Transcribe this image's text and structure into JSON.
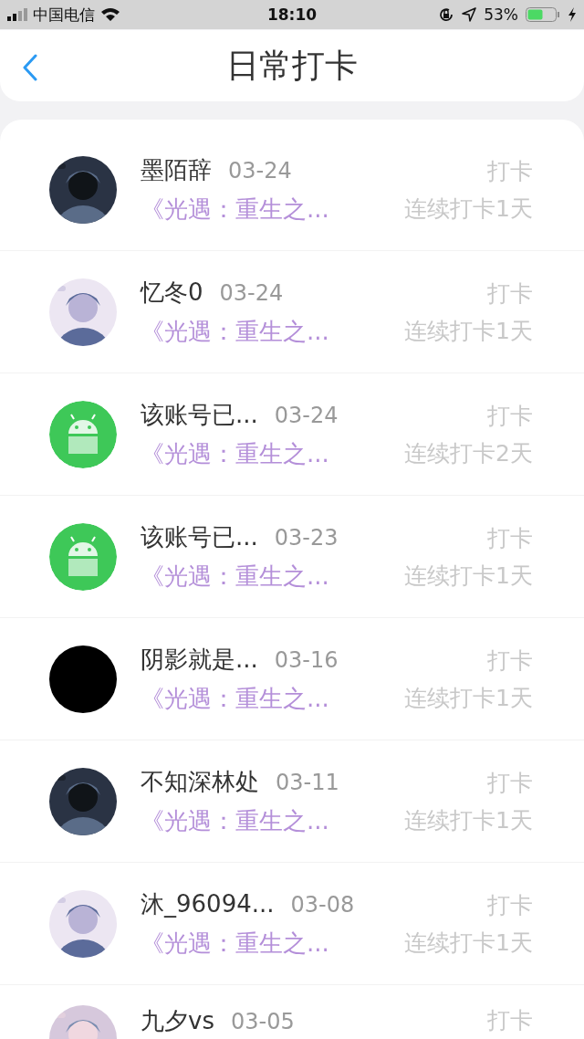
{
  "status_bar": {
    "carrier": "中国电信",
    "time": "18:10",
    "battery": "53%"
  },
  "header": {
    "title": "日常打卡"
  },
  "entries": [
    {
      "name": "墨陌辞",
      "date": "03-24",
      "action": "打卡",
      "subtitle": "《光遇：重生之...",
      "streak": "连续打卡1天"
    },
    {
      "name": "忆冬0",
      "date": "03-24",
      "action": "打卡",
      "subtitle": "《光遇：重生之...",
      "streak": "连续打卡1天"
    },
    {
      "avatar": {
        "kind": "android"
      },
      "name": "该账号已...",
      "date": "03-24",
      "action": "打卡",
      "subtitle": "《光遇：重生之...",
      "streak": "连续打卡2天"
    },
    {
      "avatar": {
        "kind": "android"
      },
      "name": "该账号已...",
      "date": "03-23",
      "action": "打卡",
      "subtitle": "《光遇：重生之...",
      "streak": "连续打卡1天"
    },
    {
      "avatar": {
        "kind": "plain"
      },
      "name": "阴影就是...",
      "date": "03-16",
      "action": "打卡",
      "subtitle": "《光遇：重生之...",
      "streak": "连续打卡1天"
    },
    {
      "name": "不知深林处",
      "date": "03-11",
      "action": "打卡",
      "subtitle": "《光遇：重生之...",
      "streak": "连续打卡1天"
    },
    {
      "name": "沐_96094...",
      "date": "03-08",
      "action": "打卡",
      "subtitle": "《光遇：重生之...",
      "streak": "连续打卡1天"
    },
    {
      "name": "九夕vs",
      "date": "03-05",
      "action": "打卡"
    }
  ]
}
